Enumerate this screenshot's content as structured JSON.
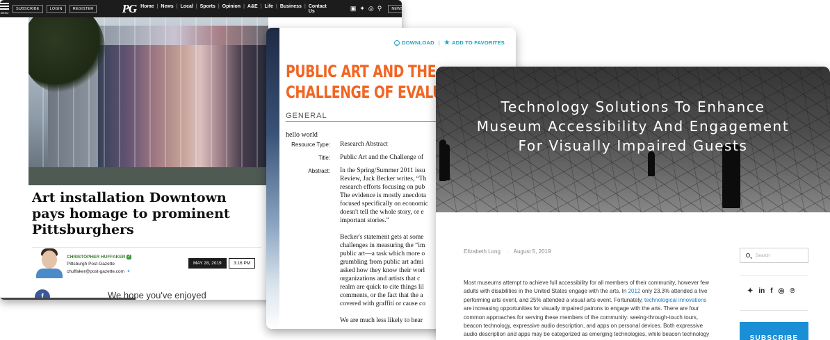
{
  "post_gazette": {
    "nav": {
      "menu_label": "MENU",
      "subscribe": "SUBSCRIBE",
      "login": "LOGIN",
      "register": "REGISTER",
      "logo": "PG",
      "links": [
        "Home",
        "News",
        "Local",
        "Sports",
        "Opinion",
        "A&E",
        "Life",
        "Business",
        "Contact Us"
      ],
      "social_icons": [
        "facebook-icon",
        "twitter-icon",
        "instagram-icon",
        "search-icon"
      ],
      "newsletters": "NEWSLETTERS"
    },
    "headline": "Art installation Downtown pays homage to prominent Pittsburghers",
    "author": {
      "name": "CHRISTOPHER HUFFAKER",
      "org": "Pittsburgh Post-Gazette",
      "email": "chuffaker@post-gazette.com"
    },
    "date": "MAY 28, 2019",
    "time": "3:16 PM",
    "share_icon": "facebook-icon",
    "body_start": "We hope you've enjoyed"
  },
  "afta": {
    "download": "DOWNLOAD",
    "add_favorites": "ADD TO FAVORITES",
    "title": "PUBLIC ART AND THE CHALLENGE OF EVALU",
    "category": "GENERAL",
    "hello": "hello world",
    "resource_type_label": "Resource Type:",
    "resource_type": "Research Abstract",
    "title_label": "Title:",
    "title_value": "Public Art and the Challenge of",
    "abstract_label": "Abstract:",
    "abstract_text": "In the Spring/Summer 2011 issu\nReview, Jack Becker writes, “Th\nresearch efforts focusing on pub\nThe evidence is mostly anecdota\nfocused specifically on economic\ndoesn't tell the whole story, or e\nimportant stories.”\n\nBecker's statement gets at some\nchallenges in measuring the “im\npublic art—a task which more o\ngrumbling from public art admi\nasked how they know their worl\norganizations and artists that c\nrealm are quick to cite things lil\ncomments, or the fact that the a\ncovered with graffiti or cause co\n\nWe are much less likely to hear"
  },
  "museum": {
    "title_lines": [
      "Technology Solutions To Enhance",
      "Museum Accessibility And Engagement",
      "For Visually Impaired Guests"
    ],
    "author": "Elizabeth Long",
    "date": "August 5, 2019",
    "body": {
      "p1": "Most museums attempt to achieve full accessibility for all members of their community, however few adults with disabilities in the United States engage with the arts. In ",
      "link1": "2012",
      "p2": " only 23.3% attended a live performing arts event, and 25% attended a visual arts event. Fortunately, ",
      "link2": "technological innovations",
      "p3": " are increasing opportunities for visually impaired patrons to engage with the arts. There are four common approaches for serving these members of the community: seeing-through-touch tours, beacon technology, expressive audio description, and apps on personal devices. Both expressive audio description and apps may be categorized as emerging technologies, while beacon technology continues to improve. Seeing-through-touch tours are often specifically designed to"
    },
    "search_placeholder": "Search",
    "social": [
      "twitter-icon",
      "linkedin-icon",
      "facebook-icon",
      "instagram-icon",
      "pinterest-icon"
    ],
    "subscribe": "SUBSCRIBE"
  },
  "colors": {
    "afta_orange": "#f26522",
    "afta_teal": "#1aa3c4",
    "pg_green": "#3a7d2e",
    "museum_link": "#2a7ab8",
    "museum_subscribe": "#1b8fd6"
  }
}
